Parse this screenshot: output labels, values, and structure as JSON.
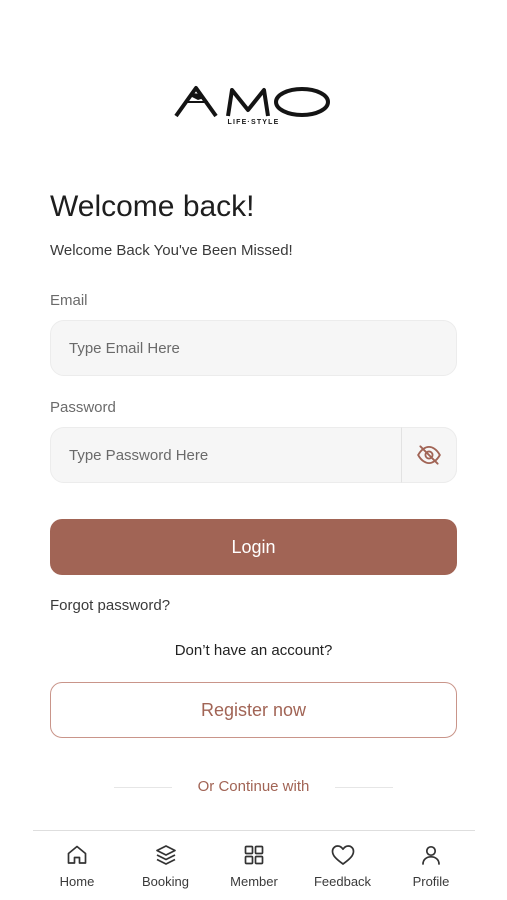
{
  "logo": {
    "wordmark": "AMO",
    "tagline": "LIFE·STYLE"
  },
  "welcome": {
    "title": "Welcome back!",
    "subtitle": "Welcome Back You've Been Missed!"
  },
  "form": {
    "email_label": "Email",
    "email_placeholder": "Type Email Here",
    "email_value": "",
    "password_label": "Password",
    "password_placeholder": "Type Password Here",
    "password_value": "",
    "toggle_icon": "eye-off-icon",
    "login_label": "Login",
    "forgot_label": "Forgot password?",
    "no_account_text": "Don’t have an account?",
    "register_label": "Register now",
    "or_continue_text": "Or Continue with"
  },
  "bottom_nav": [
    {
      "label": "Home",
      "icon": "home-icon"
    },
    {
      "label": "Booking",
      "icon": "layers-icon"
    },
    {
      "label": "Member",
      "icon": "grid-icon"
    },
    {
      "label": "Feedback",
      "icon": "heart-icon"
    },
    {
      "label": "Profile",
      "icon": "user-icon"
    }
  ],
  "colors": {
    "accent": "#a16455",
    "accent_border": "#c9958a",
    "input_bg": "#f6f6f6"
  }
}
